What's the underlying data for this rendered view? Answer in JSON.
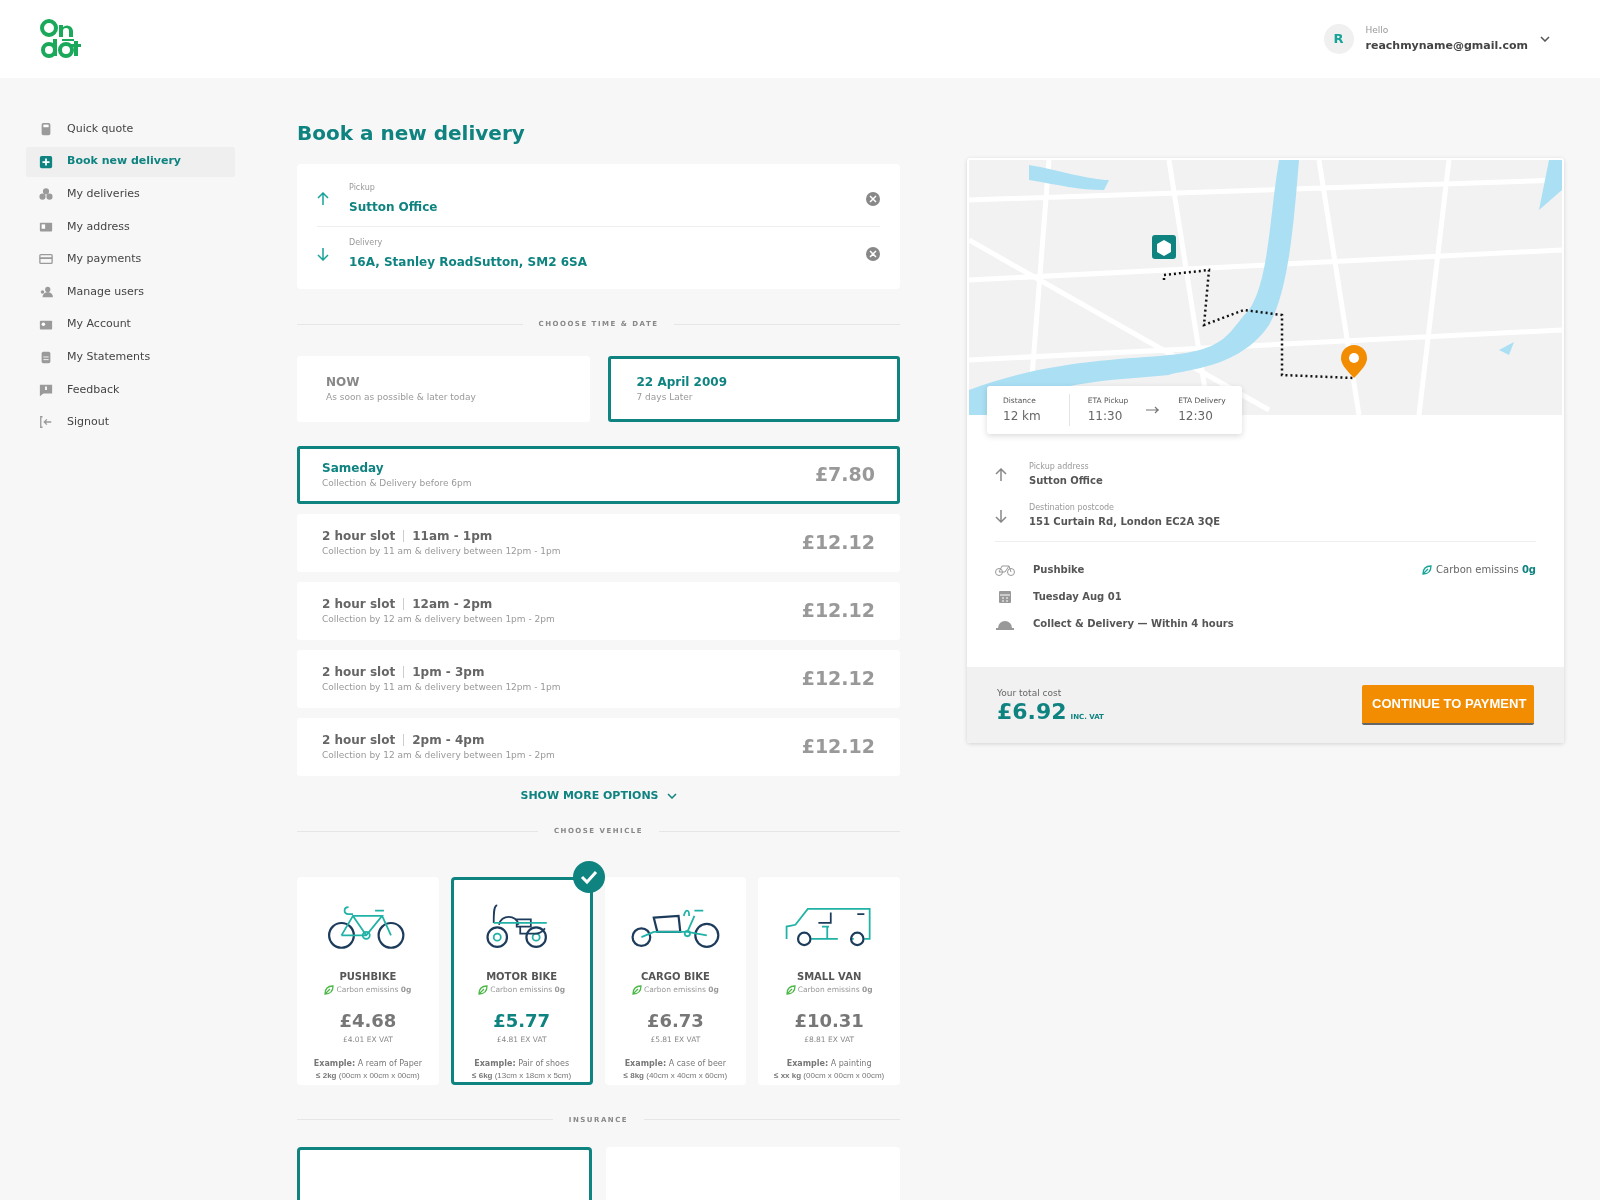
{
  "header": {
    "avatar_letter": "R",
    "greeting": "Hello",
    "email": "reachmyname@gmail.com"
  },
  "sidebar": {
    "items": [
      {
        "label": "Quick quote",
        "selected": false
      },
      {
        "label": "Book new delivery",
        "selected": true
      },
      {
        "label": "My deliveries",
        "selected": false
      },
      {
        "label": "My address",
        "selected": false
      },
      {
        "label": "My payments",
        "selected": false
      },
      {
        "label": "Manage users",
        "selected": false
      },
      {
        "label": "My Account",
        "selected": false
      },
      {
        "label": "My Statements",
        "selected": false
      },
      {
        "label": "Feedback",
        "selected": false
      },
      {
        "label": "Signout",
        "selected": false
      }
    ]
  },
  "title": "Book a new delivery",
  "addresses": [
    {
      "kind": "pickup",
      "label": "Pickup",
      "value": "Sutton Office"
    },
    {
      "kind": "delivery",
      "label": "Delivery",
      "value": "16A, Stanley RoadSutton, SM2 6SA"
    }
  ],
  "time_section": "CHOOOSE TIME & DATE",
  "when_options": [
    {
      "title": "NOW",
      "subtitle": "As soon as possible & later today",
      "selected": false
    },
    {
      "title": "22 April 2009",
      "subtitle": "7 days Later",
      "selected": true
    }
  ],
  "slots": [
    {
      "kind": "sameday",
      "title": "Sameday",
      "subtitle": "Collection & Delivery before 6pm",
      "price": "£7.80",
      "selected": true
    },
    {
      "kind": "slot",
      "title": "2 hour slot",
      "time": "11am - 1pm",
      "subtitle": "Collection by 11 am & delivery between 12pm - 1pm",
      "price": "£12.12",
      "selected": false
    },
    {
      "kind": "slot",
      "title": "2 hour slot",
      "time": "12am - 2pm",
      "subtitle": "Collection by 12 am & delivery between 1pm - 2pm",
      "price": "£12.12",
      "selected": false
    },
    {
      "kind": "slot",
      "title": "2 hour slot",
      "time": "1pm - 3pm",
      "subtitle": "Collection by 11 am & delivery between 12pm - 1pm",
      "price": "£12.12",
      "selected": false
    },
    {
      "kind": "slot",
      "title": "2 hour slot",
      "time": "2pm - 4pm",
      "subtitle": "Collection by 12 am & delivery between 1pm - 2pm",
      "price": "£12.12",
      "selected": false
    }
  ],
  "show_more": "SHOW MORE OPTIONS",
  "vehicle_section": "CHOOSE VEHICLE",
  "vehicles": [
    {
      "kind": "pushbike",
      "name": "PUSHBIKE",
      "carbon": "Carbon emissins **0g**",
      "price": "£4.68",
      "ex_vat": "£4.01 EX VAT",
      "example": "**Example:** A ream of Paper",
      "size": "**≤ 2kg** (00cm x 00cm x 00cm)",
      "selected": false
    },
    {
      "kind": "motorbike",
      "name": "MOTOR BIKE",
      "carbon": "Carbon emissins **0g**",
      "price": "£5.77",
      "ex_vat": "£4.81 EX VAT",
      "example": "**Example:** Pair of shoes",
      "size": "**≤ 6kg** (13cm x 18cm x 5cm)",
      "selected": true
    },
    {
      "kind": "cargobike",
      "name": "CARGO BIKE",
      "carbon": "Carbon emissins **0g**",
      "price": "£6.73",
      "ex_vat": "£5.81 EX VAT",
      "example": "**Example:** A case of beer",
      "size": "**≤ 8kg** (40cm x 40cm x 60cm)",
      "selected": false
    },
    {
      "kind": "van",
      "name": "SMALL VAN",
      "carbon": "Carbon emissins **0g**",
      "price": "£10.31",
      "ex_vat": "£8.81 EX VAT",
      "example": "**Example:** A painting",
      "size": "**≤ xx kg** (00cm x 00cm x 00cm)",
      "selected": false
    }
  ],
  "insurance_section": "INSURANCE",
  "insurance_options": [
    {
      "selected": true
    },
    {
      "selected": false
    }
  ],
  "summary": {
    "eta": [
      {
        "label": "Distance",
        "value": "12 km"
      },
      {
        "label": "ETA Pickup",
        "value": "11:30"
      },
      {
        "label": "ETA Delivery",
        "value": "12:30"
      }
    ],
    "route": [
      {
        "kind": "pickup",
        "label": "Pickup address",
        "value": "Sutton Office"
      },
      {
        "kind": "delivery",
        "label": "Destination postcode",
        "value": "151 Curtain Rd, London EC2A 3QE"
      }
    ],
    "details": [
      {
        "kind": "vehicle",
        "text": "Pushbike",
        "carbon": "Carbon emissins **0g**"
      },
      {
        "kind": "date",
        "text": "Tuesday Aug 01"
      },
      {
        "kind": "service",
        "text": "Collect & Delivery — Within 4 hours"
      }
    ],
    "total_label": "Your total cost",
    "total": "£6.92",
    "vat_note": "INC. VAT",
    "button": "CONTINUE TO PAYMENT"
  }
}
